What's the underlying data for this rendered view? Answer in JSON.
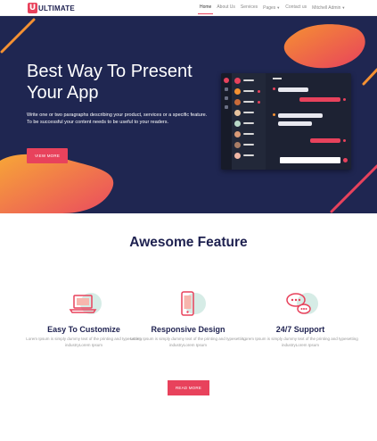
{
  "brand": {
    "mark": "U",
    "name": "ULTIMATE"
  },
  "nav": {
    "items": [
      {
        "label": "Home",
        "active": true
      },
      {
        "label": "About Us"
      },
      {
        "label": "Services"
      },
      {
        "label": "Pages",
        "dropdown": true
      },
      {
        "label": "Contact us"
      },
      {
        "label": "Mitchell Admin",
        "dropdown": true
      }
    ]
  },
  "hero": {
    "title": "Best Way To Present Your App",
    "desc1": "Write one or two paragraphs describing your product, services or a specific feature.",
    "desc2": "To be successful your content needs to be useful to your readers.",
    "button": "VIEW MORE"
  },
  "features": {
    "title": "Awesome Feature",
    "items": [
      {
        "icon": "laptop-icon",
        "name": "Easy To Customize",
        "text": "Lorem Ipsum is simply dummy text of the printing and typesetting industryLorem Ipsum"
      },
      {
        "icon": "mobile-icon",
        "name": "Responsive Design",
        "text": "Lorem Ipsum is simply dummy text of the printing and typesetting industryLorem Ipsum"
      },
      {
        "icon": "chat-support-icon",
        "name": "24/7 Support",
        "text": "Lorem Ipsum is simply dummy text of the printing and typesetting industryLorem Ipsum"
      }
    ],
    "button": "READ MORE"
  },
  "colors": {
    "accent": "#e8425c",
    "navy": "#1f2651",
    "orange": "#f59132"
  }
}
